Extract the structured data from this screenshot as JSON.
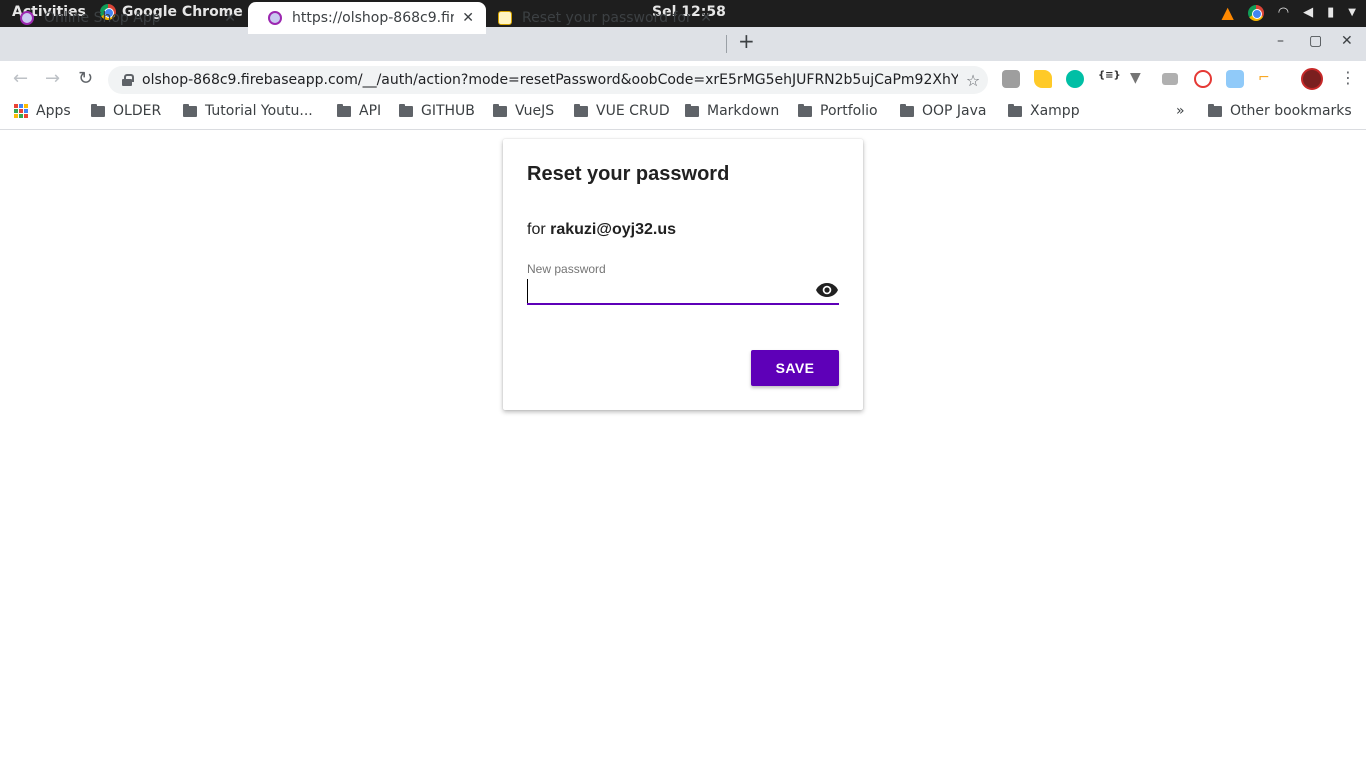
{
  "os_bar": {
    "activities": "Activities",
    "app_name": "Google Chrome",
    "clock": "Sel 12:58"
  },
  "tabs": [
    {
      "title": "Online Shop App",
      "close": "✕"
    },
    {
      "title": "https://olshop-868c9.fireb",
      "close": "✕"
    },
    {
      "title": "Reset your password for p",
      "close": "✕"
    }
  ],
  "new_tab": "+",
  "address_bar": {
    "url": "olshop-868c9.firebaseapp.com/__/auth/action?mode=resetPassword&oobCode=xrE5rMG5ehJUFRN2b5ujCaPm92XhYle-5CeBl..."
  },
  "bookmarks": [
    {
      "label": "Apps"
    },
    {
      "label": "OLDER"
    },
    {
      "label": "Tutorial Youtu..."
    },
    {
      "label": "API"
    },
    {
      "label": "GITHUB"
    },
    {
      "label": "VueJS"
    },
    {
      "label": "VUE CRUD"
    },
    {
      "label": "Markdown"
    },
    {
      "label": "Portfolio"
    },
    {
      "label": "OOP Java"
    },
    {
      "label": "Xampp"
    }
  ],
  "bookmarks_overflow": "»",
  "other_bookmarks": "Other bookmarks",
  "reset_card": {
    "title": "Reset your password",
    "for_prefix": "for",
    "email": "rakuzi@oyj32.us",
    "field_label": "New password",
    "field_value": "",
    "save_label": "SAVE"
  },
  "colors": {
    "accent": "#5e00b8",
    "os_bar": "#1e1e1e",
    "tabstrip": "#dee1e6"
  }
}
